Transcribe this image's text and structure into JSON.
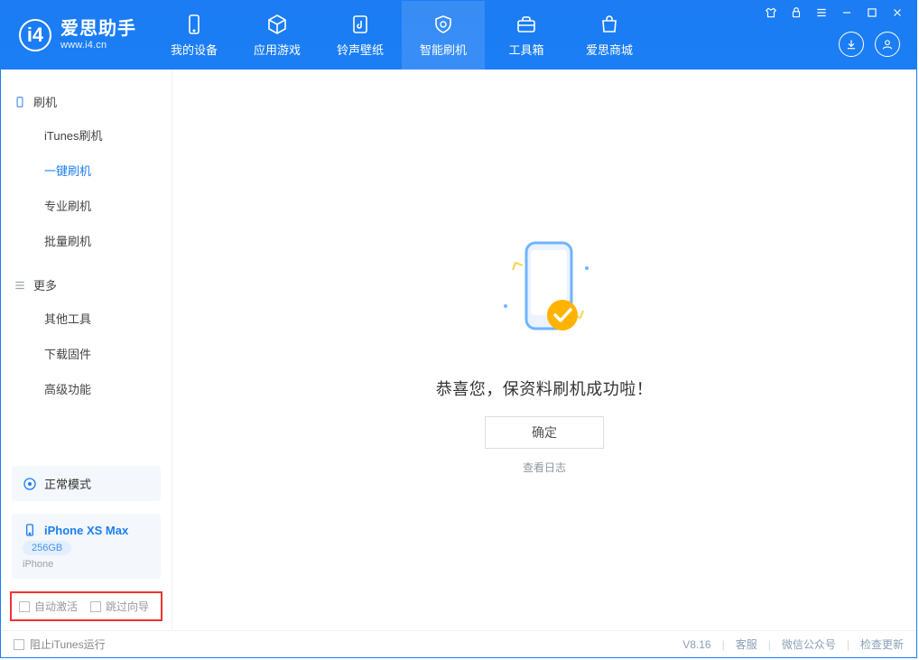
{
  "app": {
    "title": "爱思助手",
    "site": "www.i4.cn"
  },
  "tabs": [
    {
      "label": "我的设备"
    },
    {
      "label": "应用游戏"
    },
    {
      "label": "铃声壁纸"
    },
    {
      "label": "智能刷机"
    },
    {
      "label": "工具箱"
    },
    {
      "label": "爱思商城"
    }
  ],
  "sidebar": {
    "group1": {
      "head": "刷机",
      "items": [
        "iTunes刷机",
        "一键刷机",
        "专业刷机",
        "批量刷机"
      ]
    },
    "group2": {
      "head": "更多",
      "items": [
        "其他工具",
        "下载固件",
        "高级功能"
      ]
    },
    "mode": "正常模式",
    "device": {
      "name": "iPhone XS Max",
      "capacity": "256GB",
      "type": "iPhone"
    },
    "opts": {
      "a": "自动激活",
      "b": "跳过向导"
    }
  },
  "main": {
    "message": "恭喜您，保资料刷机成功啦！",
    "ok": "确定",
    "log": "查看日志"
  },
  "footer": {
    "block_itunes": "阻止iTunes运行",
    "version": "V8.16",
    "links": [
      "客服",
      "微信公众号",
      "检查更新"
    ]
  }
}
